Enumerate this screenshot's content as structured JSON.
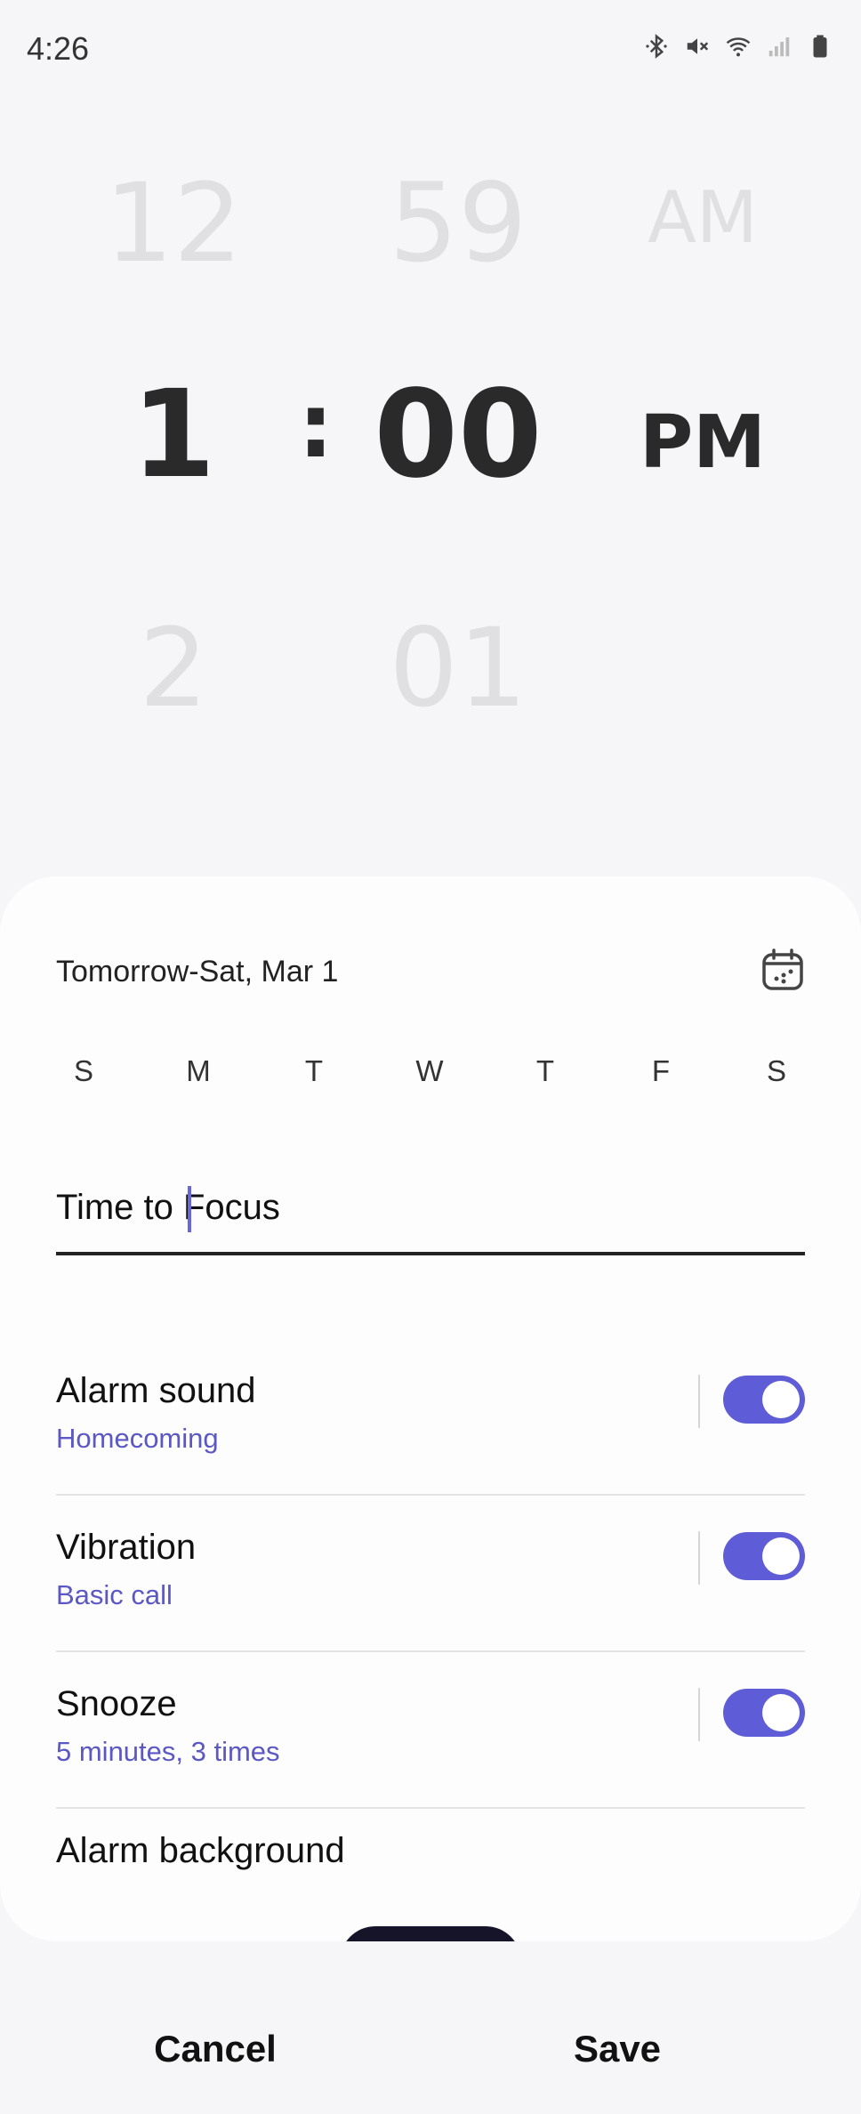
{
  "status_bar": {
    "time": "4:26",
    "icons": [
      "bluetooth-icon",
      "mute-icon",
      "wifi-icon",
      "signal-icon",
      "battery-icon"
    ]
  },
  "picker": {
    "hour": {
      "prev": "12",
      "selected": "1",
      "next": "2"
    },
    "separator": ":",
    "minute": {
      "prev": "59",
      "selected": "00",
      "next": "01"
    },
    "ampm": {
      "prev": "AM",
      "selected": "PM"
    }
  },
  "schedule": {
    "date_label": "Tomorrow-Sat, Mar 1",
    "days": [
      "S",
      "M",
      "T",
      "W",
      "T",
      "F",
      "S"
    ]
  },
  "alarm_name": {
    "value": "Time to Focus"
  },
  "settings": {
    "alarm_sound": {
      "title": "Alarm sound",
      "subtitle": "Homecoming",
      "enabled": true
    },
    "vibration": {
      "title": "Vibration",
      "subtitle": "Basic call",
      "enabled": true
    },
    "snooze": {
      "title": "Snooze",
      "subtitle": "5 minutes, 3 times",
      "enabled": true
    },
    "alarm_background": {
      "title": "Alarm background"
    }
  },
  "actions": {
    "cancel": "Cancel",
    "save": "Save"
  },
  "colors": {
    "accent": "#5f5cd7",
    "subtitle": "#5b58c4",
    "dim_picker": "#e0e0e3",
    "background": "#f6f6f8"
  }
}
